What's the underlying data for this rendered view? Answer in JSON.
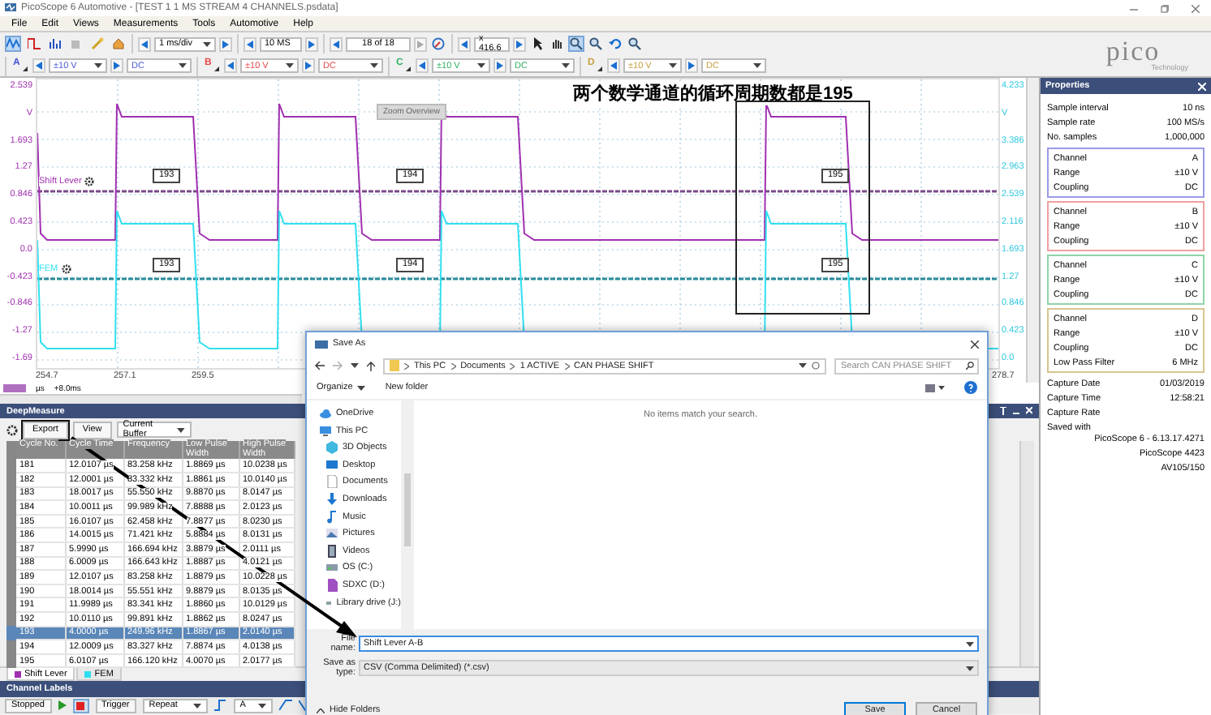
{
  "window": {
    "title": "PicoScope 6 Automotive - [TEST 1 1 MS STREAM 4 CHANNELS.psdata]"
  },
  "menu": [
    "File",
    "Edit",
    "Views",
    "Measurements",
    "Tools",
    "Automotive",
    "Help"
  ],
  "toolbar": {
    "timebase": "1 ms/div",
    "samples": "10 MS",
    "buffer": "18 of 18",
    "zoom": "x 416.6"
  },
  "channels": [
    {
      "letter": "A",
      "color": "#4a5ad8",
      "range": "±10 V",
      "coupling": "DC"
    },
    {
      "letter": "B",
      "color": "#e84a4a",
      "range": "±10 V",
      "coupling": "DC"
    },
    {
      "letter": "C",
      "color": "#34b060",
      "range": "±10 V",
      "coupling": "DC"
    },
    {
      "letter": "D",
      "color": "#c8a040",
      "range": "±10 V",
      "coupling": "DC"
    }
  ],
  "logo": {
    "word": "pico",
    "tagline": "Technology"
  },
  "scope": {
    "annotation": "两个数学通道的循环周期数都是195",
    "left_axis": [
      "2.539",
      "V",
      "1.693",
      "1.27",
      "0.846",
      "0.423",
      "0.0",
      "-0.423",
      "-0.846",
      "-1.27",
      "-1.69"
    ],
    "right_axis": [
      "4.233",
      "V",
      "3.386",
      "2.963",
      "2.539",
      "2.116",
      "1.693",
      "1.27",
      "0.846",
      "0.423",
      "0.0"
    ],
    "x_axis": [
      "254.7",
      "257.1",
      "259.5",
      "278.7"
    ],
    "traces": [
      {
        "name": "Shift Lever",
        "color": "#a030b0"
      },
      {
        "name": "FEM",
        "color": "#30e0f0"
      }
    ],
    "cycle_markers_upper": [
      "193",
      "194",
      "195"
    ],
    "cycle_markers_lower": [
      "193",
      "194",
      "195"
    ],
    "zoom_overview": "Zoom Overview",
    "unit": "µs",
    "offset": "+8.0ms"
  },
  "properties": {
    "title": "Properties",
    "info": [
      {
        "label": "Sample interval",
        "value": "10 ns"
      },
      {
        "label": "Sample rate",
        "value": "100 MS/s"
      },
      {
        "label": "No. samples",
        "value": "1,000,000"
      }
    ],
    "groups": [
      {
        "color": "#9a9ae8",
        "rows": [
          {
            "label": "Channel",
            "value": "A"
          },
          {
            "label": "Range",
            "value": "±10 V"
          },
          {
            "label": "Coupling",
            "value": "DC"
          }
        ]
      },
      {
        "color": "#f0a0a0",
        "rows": [
          {
            "label": "Channel",
            "value": "B"
          },
          {
            "label": "Range",
            "value": "±10 V"
          },
          {
            "label": "Coupling",
            "value": "DC"
          }
        ]
      },
      {
        "color": "#90d4a8",
        "rows": [
          {
            "label": "Channel",
            "value": "C"
          },
          {
            "label": "Range",
            "value": "±10 V"
          },
          {
            "label": "Coupling",
            "value": "DC"
          }
        ]
      },
      {
        "color": "#d8c490",
        "rows": [
          {
            "label": "Channel",
            "value": "D"
          },
          {
            "label": "Range",
            "value": "±10 V"
          },
          {
            "label": "Coupling",
            "value": "DC"
          },
          {
            "label": "Low Pass Filter",
            "value": "6 MHz"
          }
        ]
      }
    ],
    "capture": [
      {
        "label": "Capture Date",
        "value": "01/03/2019"
      },
      {
        "label": "Capture Time",
        "value": "12:58:21"
      },
      {
        "label": "Capture Rate"
      },
      {
        "label": "Saved with"
      }
    ],
    "saved_with": [
      "PicoScope 6 - 6.13.17.4271",
      "PicoScope 4423",
      "AV105/150"
    ]
  },
  "deep_measure": {
    "title": "DeepMeasure",
    "export": "Export",
    "view": "View",
    "buffer": "Current Buffer",
    "columns": [
      "Cycle No.",
      "Cycle Time",
      "Frequency",
      "Low Pulse Width",
      "High Pulse Width"
    ],
    "rows": [
      {
        "selected": false,
        "cells": [
          "181",
          "12.0107 µs",
          "83.258 kHz",
          "1.8869 µs",
          "10.0238 µs"
        ]
      },
      {
        "selected": false,
        "cells": [
          "182",
          "12.0001 µs",
          "83.332 kHz",
          "1.8861 µs",
          "10.0140 µs"
        ]
      },
      {
        "selected": false,
        "cells": [
          "183",
          "18.0017 µs",
          "55.550 kHz",
          "9.8870 µs",
          "8.0147 µs"
        ]
      },
      {
        "selected": false,
        "cells": [
          "184",
          "10.0011 µs",
          "99.989 kHz",
          "7.8888 µs",
          "2.0123 µs"
        ]
      },
      {
        "selected": false,
        "cells": [
          "185",
          "16.0107 µs",
          "62.458 kHz",
          "7.8877 µs",
          "8.0230 µs"
        ]
      },
      {
        "selected": false,
        "cells": [
          "186",
          "14.0015 µs",
          "71.421 kHz",
          "5.8884 µs",
          "8.0131 µs"
        ]
      },
      {
        "selected": false,
        "cells": [
          "187",
          "5.9990 µs",
          "166.694 kHz",
          "3.8879 µs",
          "2.0111 µs"
        ]
      },
      {
        "selected": false,
        "cells": [
          "188",
          "6.0009 µs",
          "166.643 kHz",
          "1.8887 µs",
          "4.0121 µs"
        ]
      },
      {
        "selected": false,
        "cells": [
          "189",
          "12.0107 µs",
          "83.258 kHz",
          "1.8879 µs",
          "10.0228 µs"
        ]
      },
      {
        "selected": false,
        "cells": [
          "190",
          "18.0014 µs",
          "55.551 kHz",
          "9.8879 µs",
          "8.0135 µs"
        ]
      },
      {
        "selected": false,
        "cells": [
          "191",
          "11.9989 µs",
          "83.341 kHz",
          "1.8860 µs",
          "10.0129 µs"
        ]
      },
      {
        "selected": false,
        "cells": [
          "192",
          "10.0110 µs",
          "99.891 kHz",
          "1.8862 µs",
          "8.0247 µs"
        ]
      },
      {
        "selected": true,
        "cells": [
          "193",
          "4.0000 µs",
          "249.96 kHz",
          "1.8867 µs",
          "2.0140 µs"
        ]
      },
      {
        "selected": false,
        "cells": [
          "194",
          "12.0009 µs",
          "83.327 kHz",
          "7.8874 µs",
          "4.0138 µs"
        ]
      },
      {
        "selected": false,
        "cells": [
          "195",
          "6.0107 µs",
          "166.120 kHz",
          "4.0070 µs",
          "2.0177 µs"
        ]
      }
    ],
    "tabs": [
      {
        "label": "Shift Lever",
        "color": "#a030b0",
        "selected": true
      },
      {
        "label": "FEM",
        "color": "#30e0f0",
        "selected": false
      }
    ]
  },
  "channel_labels": {
    "title": "Channel Labels"
  },
  "status_bar": {
    "state": "Stopped",
    "trigger": "Trigger",
    "mode": "Repeat",
    "source": "A"
  },
  "dialog": {
    "title": "Save As",
    "path": [
      "This PC",
      "Documents",
      "1 ACTIVE",
      "CAN PHASE SHIFT"
    ],
    "search_placeholder": "Search CAN PHASE SHIFT",
    "organize": "Organize",
    "new_folder": "New folder",
    "nav": [
      {
        "label": "OneDrive",
        "kind": "cloud"
      },
      {
        "label": "This PC",
        "kind": "computer",
        "children": [
          {
            "label": "3D Objects",
            "kind": "cube"
          },
          {
            "label": "Desktop",
            "kind": "desktop"
          },
          {
            "label": "Documents",
            "kind": "document"
          },
          {
            "label": "Downloads",
            "kind": "download"
          },
          {
            "label": "Music",
            "kind": "music"
          },
          {
            "label": "Pictures",
            "kind": "picture"
          },
          {
            "label": "Videos",
            "kind": "video"
          },
          {
            "label": "OS (C:)",
            "kind": "drive"
          },
          {
            "label": "SDXC (D:)",
            "kind": "card"
          },
          {
            "label": "Library drive (J:)",
            "kind": "drive"
          }
        ]
      }
    ],
    "empty_message": "No items match your search.",
    "file_name_label": "File name:",
    "file_name": "Shift Lever A-B",
    "type_label": "Save as type:",
    "file_type": "CSV (Comma Delimited) (*.csv)",
    "hide_folders": "Hide Folders",
    "save": "Save",
    "cancel": "Cancel"
  }
}
